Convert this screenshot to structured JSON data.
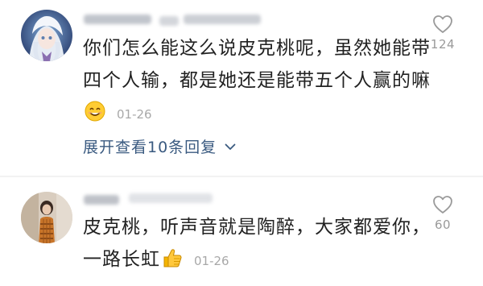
{
  "comments": [
    {
      "username": "",
      "text": "你们怎么能这么说皮克桃呢，虽然她能带四个人输，都是她还是能带五个人赢的嘛",
      "emoji": "smiling-face-emoji",
      "date": "01-26",
      "likes": "124",
      "expand_label": "展开查看10条回复"
    },
    {
      "username": "",
      "text": "皮克桃，听声音就是陶醉，大家都爱你，一路长虹",
      "emoji": "thumbs-up-emoji",
      "date": "01-26",
      "likes": "60"
    }
  ]
}
